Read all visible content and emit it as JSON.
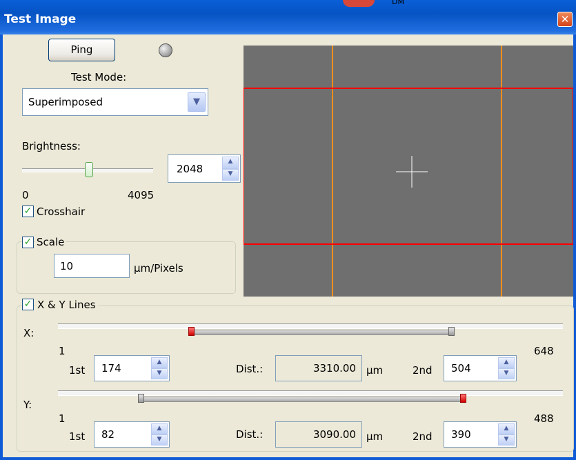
{
  "window": {
    "title": "Test Image",
    "close_glyph": "✕",
    "partial_top_text": "DM"
  },
  "controls": {
    "ping_label": "Ping",
    "test_mode_label": "Test Mode:",
    "test_mode_value": "Superimposed",
    "brightness_label": "Brightness:",
    "brightness_value": "2048",
    "brightness_min": "0",
    "brightness_max": "4095",
    "brightness_level": 0.5,
    "crosshair_label": "Crosshair",
    "crosshair_checked": true,
    "scale_label": "Scale",
    "scale_checked": true,
    "scale_value": "10",
    "scale_unit": "µm/Pixels",
    "xy_lines_label": "X & Y Lines",
    "xy_lines_checked": true
  },
  "x_lines": {
    "axis_label": "X:",
    "min": "1",
    "max": "648",
    "first_label": "1st",
    "first_value": "174",
    "second_label": "2nd",
    "second_value": "504",
    "dist_label": "Dist.:",
    "dist_value": "3310.00",
    "dist_unit": "µm"
  },
  "y_lines": {
    "axis_label": "Y:",
    "min": "1",
    "max": "488",
    "first_label": "1st",
    "first_value": "82",
    "second_label": "2nd",
    "second_value": "390",
    "dist_label": "Dist.:",
    "dist_value": "3090.00",
    "dist_unit": "µm"
  },
  "colors": {
    "preview_background": "#6f6f6f",
    "vertical_lines": "#f28c1c",
    "horizontal_box": "#ff0000",
    "crosshair": "#ffffff"
  },
  "icons": {
    "close": "close-icon",
    "status": "status-led-icon",
    "dropdown": "chevron-down-icon",
    "spin": "spin-arrows-icon",
    "check": "checkmark-icon"
  }
}
